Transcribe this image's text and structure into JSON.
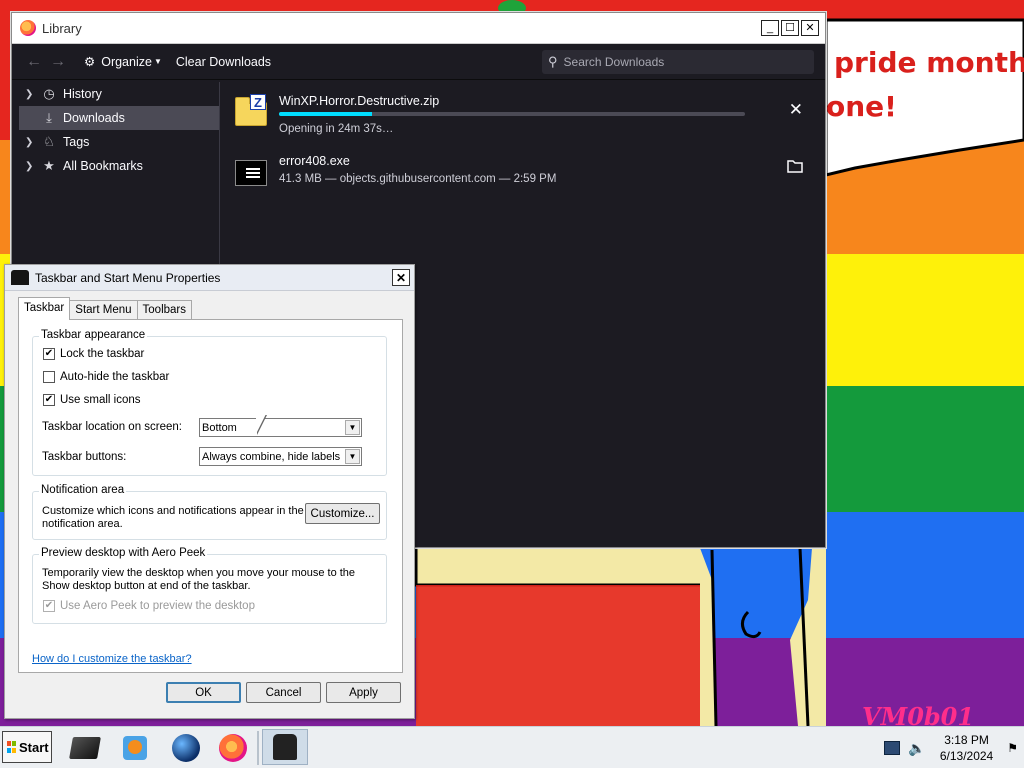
{
  "desktop": {
    "wallpaper_text_line1": "pride month",
    "wallpaper_text_line2": "one!",
    "wallpaper_signature": "VM0b01"
  },
  "library": {
    "title": "Library",
    "window_controls": {
      "minimize": "_",
      "maximize": "☐",
      "close": "✕"
    },
    "toolbar": {
      "organize_label": "Organize",
      "clear_downloads_label": "Clear Downloads",
      "search_placeholder": "Search Downloads"
    },
    "sidebar": [
      {
        "label": "History",
        "icon": "clock-icon"
      },
      {
        "label": "Downloads",
        "icon": "download-icon",
        "active": true
      },
      {
        "label": "Tags",
        "icon": "tag-icon"
      },
      {
        "label": "All Bookmarks",
        "icon": "star-icon"
      }
    ],
    "downloads": [
      {
        "name": "WinXP.Horror.Destructive.zip",
        "status": "Opening in 24m 37s…",
        "progress": 0.2,
        "action_icon": "cancel-icon",
        "file_icon": "zip-folder-icon"
      },
      {
        "name": "error408.exe",
        "status": "41.3 MB — objects.githubusercontent.com — 2:59 PM",
        "action_icon": "folder-icon",
        "file_icon": "exe-icon"
      }
    ],
    "colors": {
      "background": "#1c1b22",
      "progress": "#00ddff",
      "text": "#fbfbfe"
    }
  },
  "dialog": {
    "title": "Taskbar and Start Menu Properties",
    "tabs": [
      "Taskbar",
      "Start Menu",
      "Toolbars"
    ],
    "active_tab": "Taskbar",
    "appearance": {
      "group_title": "Taskbar appearance",
      "lock_label": "Lock the taskbar",
      "lock_checked": true,
      "autohide_label": "Auto-hide the taskbar",
      "autohide_checked": false,
      "small_icons_label": "Use small icons",
      "small_icons_checked": true,
      "location_label": "Taskbar location on screen:",
      "location_value": "Bottom",
      "buttons_label": "Taskbar buttons:",
      "buttons_value": "Always combine, hide labels"
    },
    "notification": {
      "group_title": "Notification area",
      "description": "Customize which icons and notifications appear in the notification area.",
      "customize_label": "Customize..."
    },
    "peek": {
      "group_title": "Preview desktop with Aero Peek",
      "description": "Temporarily view the desktop when you move your mouse to the Show desktop button at end of the taskbar.",
      "checkbox_label": "Use Aero Peek to preview the desktop",
      "checked": true,
      "disabled": true
    },
    "help_link": "How do I customize the taskbar?",
    "buttons": {
      "ok": "OK",
      "cancel": "Cancel",
      "apply": "Apply"
    },
    "close_glyph": "✕"
  },
  "taskbar": {
    "start_label": "Start",
    "apps": [
      "cube-app-icon",
      "media-player-icon",
      "globe-icon",
      "firefox-icon",
      "taskbar-properties-icon"
    ],
    "clock_time": "3:18 PM",
    "clock_date": "6/13/2024"
  }
}
